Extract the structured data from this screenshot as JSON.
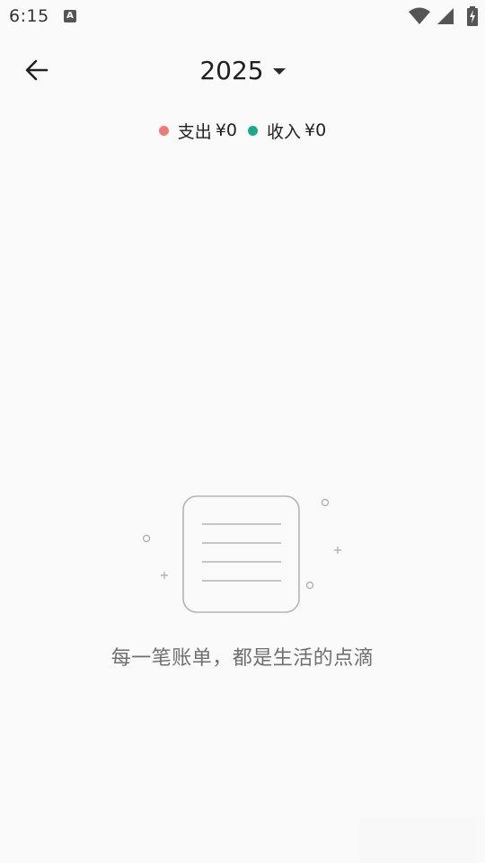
{
  "status_bar": {
    "time": "6:15",
    "notification_icon": "a-letter-icon",
    "notification_glyph": "A",
    "icons": [
      "wifi-icon",
      "signal-icon",
      "battery-charging-icon"
    ]
  },
  "header": {
    "back_icon": "arrow-left-icon",
    "year": "2025",
    "dropdown_icon": "caret-down-icon"
  },
  "legend": {
    "expense": {
      "label": "支出",
      "amount": "¥0",
      "color": "#ef7a78"
    },
    "income": {
      "label": "收入",
      "amount": "¥0",
      "color": "#1aa98a"
    }
  },
  "empty_state": {
    "illustration_icon": "empty-bill-icon",
    "message": "每一笔账单，都是生活的点滴"
  }
}
